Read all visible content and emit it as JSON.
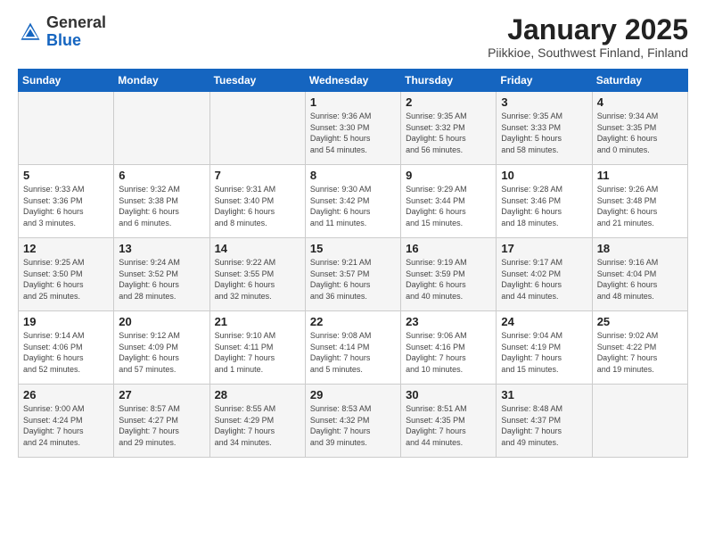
{
  "header": {
    "logo_general": "General",
    "logo_blue": "Blue",
    "month_title": "January 2025",
    "location": "Piikkioe, Southwest Finland, Finland"
  },
  "days_of_week": [
    "Sunday",
    "Monday",
    "Tuesday",
    "Wednesday",
    "Thursday",
    "Friday",
    "Saturday"
  ],
  "weeks": [
    [
      {
        "day": "",
        "info": ""
      },
      {
        "day": "",
        "info": ""
      },
      {
        "day": "",
        "info": ""
      },
      {
        "day": "1",
        "info": "Sunrise: 9:36 AM\nSunset: 3:30 PM\nDaylight: 5 hours\nand 54 minutes."
      },
      {
        "day": "2",
        "info": "Sunrise: 9:35 AM\nSunset: 3:32 PM\nDaylight: 5 hours\nand 56 minutes."
      },
      {
        "day": "3",
        "info": "Sunrise: 9:35 AM\nSunset: 3:33 PM\nDaylight: 5 hours\nand 58 minutes."
      },
      {
        "day": "4",
        "info": "Sunrise: 9:34 AM\nSunset: 3:35 PM\nDaylight: 6 hours\nand 0 minutes."
      }
    ],
    [
      {
        "day": "5",
        "info": "Sunrise: 9:33 AM\nSunset: 3:36 PM\nDaylight: 6 hours\nand 3 minutes."
      },
      {
        "day": "6",
        "info": "Sunrise: 9:32 AM\nSunset: 3:38 PM\nDaylight: 6 hours\nand 6 minutes."
      },
      {
        "day": "7",
        "info": "Sunrise: 9:31 AM\nSunset: 3:40 PM\nDaylight: 6 hours\nand 8 minutes."
      },
      {
        "day": "8",
        "info": "Sunrise: 9:30 AM\nSunset: 3:42 PM\nDaylight: 6 hours\nand 11 minutes."
      },
      {
        "day": "9",
        "info": "Sunrise: 9:29 AM\nSunset: 3:44 PM\nDaylight: 6 hours\nand 15 minutes."
      },
      {
        "day": "10",
        "info": "Sunrise: 9:28 AM\nSunset: 3:46 PM\nDaylight: 6 hours\nand 18 minutes."
      },
      {
        "day": "11",
        "info": "Sunrise: 9:26 AM\nSunset: 3:48 PM\nDaylight: 6 hours\nand 21 minutes."
      }
    ],
    [
      {
        "day": "12",
        "info": "Sunrise: 9:25 AM\nSunset: 3:50 PM\nDaylight: 6 hours\nand 25 minutes."
      },
      {
        "day": "13",
        "info": "Sunrise: 9:24 AM\nSunset: 3:52 PM\nDaylight: 6 hours\nand 28 minutes."
      },
      {
        "day": "14",
        "info": "Sunrise: 9:22 AM\nSunset: 3:55 PM\nDaylight: 6 hours\nand 32 minutes."
      },
      {
        "day": "15",
        "info": "Sunrise: 9:21 AM\nSunset: 3:57 PM\nDaylight: 6 hours\nand 36 minutes."
      },
      {
        "day": "16",
        "info": "Sunrise: 9:19 AM\nSunset: 3:59 PM\nDaylight: 6 hours\nand 40 minutes."
      },
      {
        "day": "17",
        "info": "Sunrise: 9:17 AM\nSunset: 4:02 PM\nDaylight: 6 hours\nand 44 minutes."
      },
      {
        "day": "18",
        "info": "Sunrise: 9:16 AM\nSunset: 4:04 PM\nDaylight: 6 hours\nand 48 minutes."
      }
    ],
    [
      {
        "day": "19",
        "info": "Sunrise: 9:14 AM\nSunset: 4:06 PM\nDaylight: 6 hours\nand 52 minutes."
      },
      {
        "day": "20",
        "info": "Sunrise: 9:12 AM\nSunset: 4:09 PM\nDaylight: 6 hours\nand 57 minutes."
      },
      {
        "day": "21",
        "info": "Sunrise: 9:10 AM\nSunset: 4:11 PM\nDaylight: 7 hours\nand 1 minute."
      },
      {
        "day": "22",
        "info": "Sunrise: 9:08 AM\nSunset: 4:14 PM\nDaylight: 7 hours\nand 5 minutes."
      },
      {
        "day": "23",
        "info": "Sunrise: 9:06 AM\nSunset: 4:16 PM\nDaylight: 7 hours\nand 10 minutes."
      },
      {
        "day": "24",
        "info": "Sunrise: 9:04 AM\nSunset: 4:19 PM\nDaylight: 7 hours\nand 15 minutes."
      },
      {
        "day": "25",
        "info": "Sunrise: 9:02 AM\nSunset: 4:22 PM\nDaylight: 7 hours\nand 19 minutes."
      }
    ],
    [
      {
        "day": "26",
        "info": "Sunrise: 9:00 AM\nSunset: 4:24 PM\nDaylight: 7 hours\nand 24 minutes."
      },
      {
        "day": "27",
        "info": "Sunrise: 8:57 AM\nSunset: 4:27 PM\nDaylight: 7 hours\nand 29 minutes."
      },
      {
        "day": "28",
        "info": "Sunrise: 8:55 AM\nSunset: 4:29 PM\nDaylight: 7 hours\nand 34 minutes."
      },
      {
        "day": "29",
        "info": "Sunrise: 8:53 AM\nSunset: 4:32 PM\nDaylight: 7 hours\nand 39 minutes."
      },
      {
        "day": "30",
        "info": "Sunrise: 8:51 AM\nSunset: 4:35 PM\nDaylight: 7 hours\nand 44 minutes."
      },
      {
        "day": "31",
        "info": "Sunrise: 8:48 AM\nSunset: 4:37 PM\nDaylight: 7 hours\nand 49 minutes."
      },
      {
        "day": "",
        "info": ""
      }
    ]
  ]
}
